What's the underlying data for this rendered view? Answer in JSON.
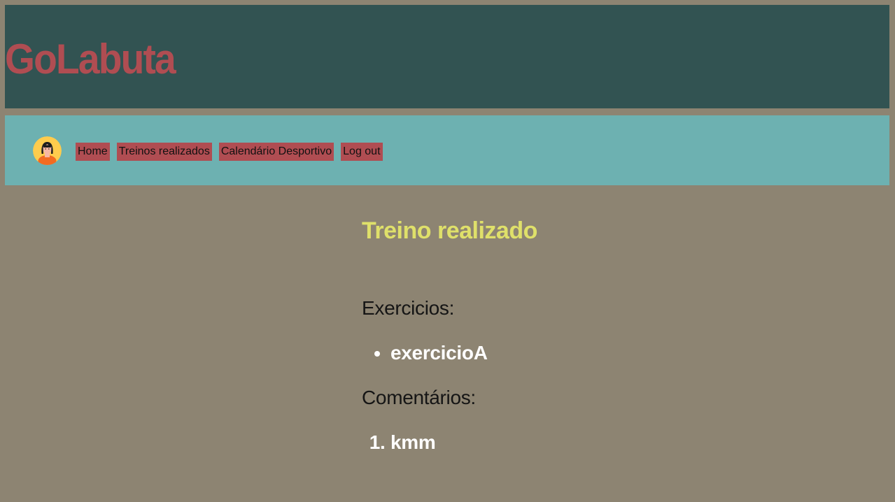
{
  "header": {
    "brand": "GoLabuta"
  },
  "nav": {
    "avatar_icon": "user-avatar-icon",
    "links": [
      {
        "label": "Home"
      },
      {
        "label": "Treinos realizados"
      },
      {
        "label": "Calendário Desportivo"
      },
      {
        "label": "Log out"
      }
    ]
  },
  "main": {
    "title": "Treino realizado",
    "exercises": {
      "heading": "Exercicios:",
      "items": [
        "exercicioA"
      ]
    },
    "comments": {
      "heading": "Comentários:",
      "items": [
        "kmm"
      ]
    }
  },
  "colors": {
    "page_bg": "#8d8472",
    "header_bg": "#325352",
    "brand": "#b04d52",
    "nav_bg": "#6db1b1",
    "nav_link_bg": "#b04d52",
    "title": "#dfe06a",
    "list_text": "#ffffff"
  }
}
